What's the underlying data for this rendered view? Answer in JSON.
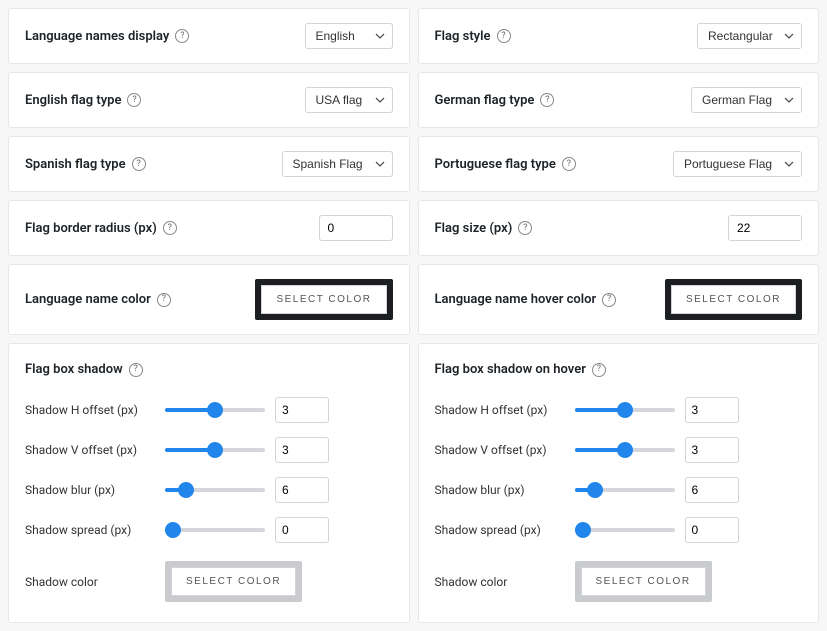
{
  "left": {
    "langDisplay": {
      "label": "Language names display",
      "value": "English"
    },
    "englishFlag": {
      "label": "English flag type",
      "value": "USA flag"
    },
    "spanishFlag": {
      "label": "Spanish flag type",
      "value": "Spanish Flag"
    },
    "borderRadius": {
      "label": "Flag border radius (px)",
      "value": "0"
    },
    "nameColor": {
      "label": "Language name color",
      "button": "SELECT COLOR"
    },
    "shadow": {
      "title": "Flag box shadow",
      "h": {
        "label": "Shadow H offset (px)",
        "value": "3",
        "min": 0,
        "max": 6
      },
      "v": {
        "label": "Shadow V offset (px)",
        "value": "3",
        "min": 0,
        "max": 6
      },
      "blur": {
        "label": "Shadow blur (px)",
        "value": "6",
        "min": 0,
        "max": 40
      },
      "spread": {
        "label": "Shadow spread (px)",
        "value": "0",
        "min": 0,
        "max": 20
      },
      "color": {
        "label": "Shadow color",
        "button": "SELECT COLOR"
      }
    }
  },
  "right": {
    "flagStyle": {
      "label": "Flag style",
      "value": "Rectangular"
    },
    "germanFlag": {
      "label": "German flag type",
      "value": "German Flag"
    },
    "portugueseFlag": {
      "label": "Portuguese flag type",
      "value": "Portuguese Flag"
    },
    "flagSize": {
      "label": "Flag size (px)",
      "value": "22"
    },
    "hoverColor": {
      "label": "Language name hover color",
      "button": "SELECT COLOR"
    },
    "shadow": {
      "title": "Flag box shadow on hover",
      "h": {
        "label": "Shadow H offset (px)",
        "value": "3",
        "min": 0,
        "max": 6
      },
      "v": {
        "label": "Shadow V offset (px)",
        "value": "3",
        "min": 0,
        "max": 6
      },
      "blur": {
        "label": "Shadow blur (px)",
        "value": "6",
        "min": 0,
        "max": 40
      },
      "spread": {
        "label": "Shadow spread (px)",
        "value": "0",
        "min": 0,
        "max": 20
      },
      "color": {
        "label": "Shadow color",
        "button": "SELECT COLOR"
      }
    }
  }
}
